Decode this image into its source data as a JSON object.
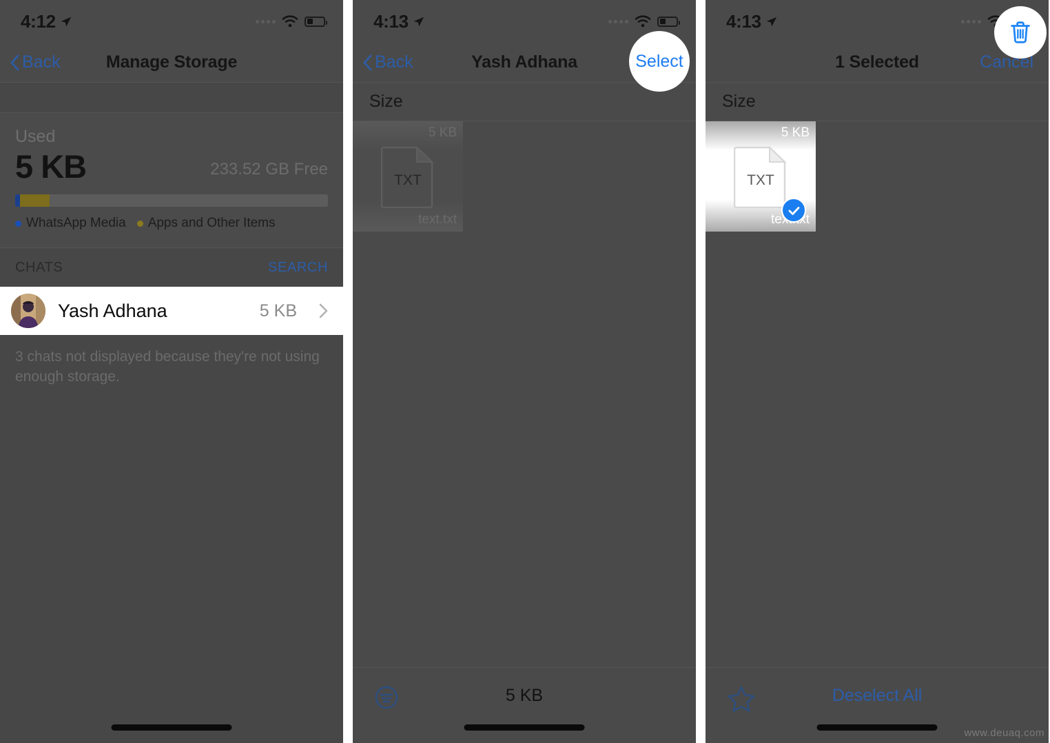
{
  "meta": {
    "watermark": "www.deuaq.com",
    "accent_blue": "#2d5da8",
    "highlight_blue": "#1d7cf2",
    "panel_bg": "#4a4a4a",
    "check_blue": "#1a7ef0"
  },
  "panel1": {
    "status": {
      "time": "4:12",
      "location_icon": "location-arrow-icon",
      "wifi_icon": "wifi-icon",
      "battery_icon": "battery-icon"
    },
    "nav": {
      "back_label": "Back",
      "title": "Manage Storage"
    },
    "storage": {
      "used_label": "Used",
      "used_value": "5 KB",
      "free_value": "233.52 GB Free",
      "legend": [
        {
          "label": "WhatsApp Media",
          "color": "#1a4fb5",
          "percent": 1.6
        },
        {
          "label": "Apps and Other Items",
          "color": "#8c7a1e",
          "percent": 9.5
        }
      ]
    },
    "chats_section": {
      "header": "CHATS",
      "action": "SEARCH",
      "rows": [
        {
          "name": "Yash Adhana",
          "size": "5 KB",
          "avatar": "user-avatar"
        }
      ],
      "footnote": "3 chats not displayed because they're not using enough storage."
    }
  },
  "panel2": {
    "status": {
      "time": "4:13",
      "location_icon": "location-arrow-icon",
      "wifi_icon": "wifi-icon",
      "battery_icon": "battery-icon"
    },
    "nav": {
      "back_label": "Back",
      "title": "Yash Adhana",
      "action_label": "Select"
    },
    "list_header": "Size",
    "files": [
      {
        "size": "5 KB",
        "name": "text.txt",
        "type": "TXT",
        "selected": false
      }
    ],
    "toolbar": {
      "sort_icon": "sort-icon",
      "total": "5 KB"
    }
  },
  "panel3": {
    "status": {
      "time": "4:13",
      "location_icon": "location-arrow-icon",
      "wifi_icon": "wifi-icon",
      "battery_icon": "battery-icon"
    },
    "nav": {
      "title": "1 Selected",
      "action_label": "Cancel"
    },
    "list_header": "Size",
    "files": [
      {
        "size": "5 KB",
        "name": "text.txt",
        "type": "TXT",
        "selected": true
      }
    ],
    "toolbar": {
      "star_icon": "star-icon",
      "action_label": "Deselect All",
      "delete_icon": "trash-icon"
    }
  }
}
